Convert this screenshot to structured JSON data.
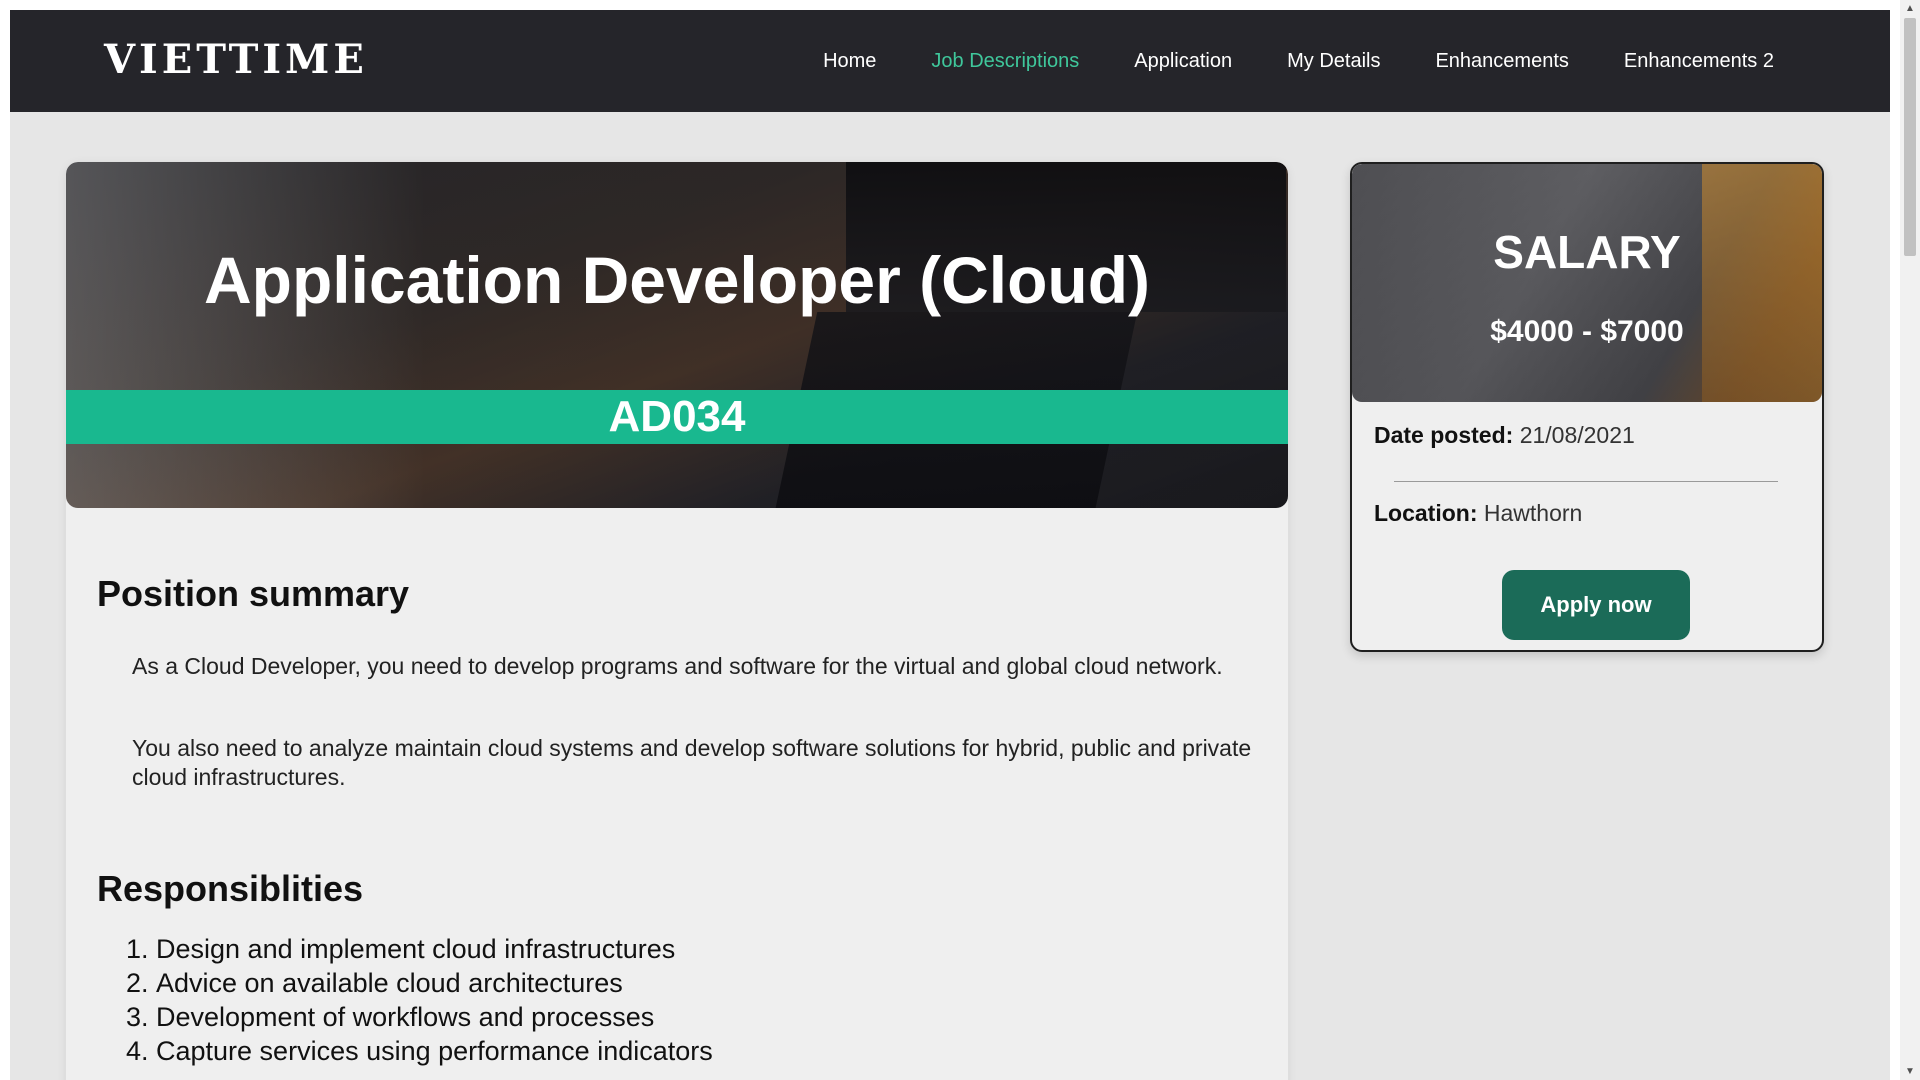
{
  "navbar": {
    "logo": "VIETTIME",
    "links": [
      {
        "label": "Home",
        "active": false
      },
      {
        "label": "Job Descriptions",
        "active": true
      },
      {
        "label": "Application",
        "active": false
      },
      {
        "label": "My Details",
        "active": false
      },
      {
        "label": "Enhancements",
        "active": false
      },
      {
        "label": "Enhancements 2",
        "active": false
      }
    ]
  },
  "job": {
    "title": "Application Developer (Cloud)",
    "code": "AD034"
  },
  "summary": {
    "heading": "Position summary",
    "paragraphs": [
      "As a Cloud Developer, you need to develop programs and software for the virtual and global cloud network.",
      "You also need to analyze maintain cloud systems and develop software solutions for hybrid, public and private cloud infrastructures."
    ]
  },
  "responsibilities": {
    "heading": "Responsiblities",
    "items": [
      "Design and implement cloud infrastructures",
      "Advice on available cloud architectures",
      "Development of workflows and processes",
      "Capture services using performance indicators"
    ]
  },
  "salary": {
    "title": "SALARY",
    "range": "$4000 - $7000",
    "date_label": "Date posted:",
    "date_value": "21/08/2021",
    "location_label": "Location:",
    "location_value": "Hawthorn",
    "apply_label": "Apply now"
  },
  "colors": {
    "navbar_bg": "#25252a",
    "accent_green": "#19b88f",
    "active_link": "#3fc79b",
    "apply_button": "#1b6b58",
    "page_bg": "#e6e6e6"
  }
}
